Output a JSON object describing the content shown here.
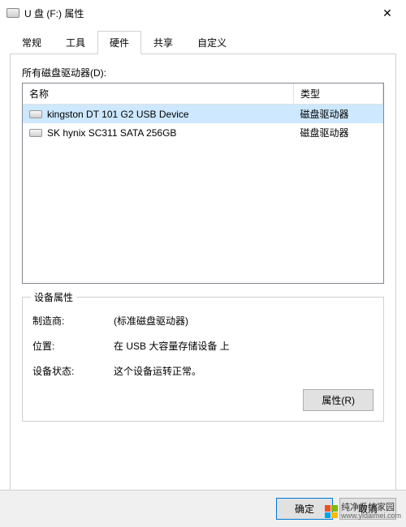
{
  "window": {
    "title": "U 盘 (F:) 属性"
  },
  "tabs": [
    {
      "label": "常规"
    },
    {
      "label": "工具"
    },
    {
      "label": "硬件"
    },
    {
      "label": "共享"
    },
    {
      "label": "自定义"
    }
  ],
  "active_tab_index": 2,
  "list_label": "所有磁盘驱动器(D):",
  "columns": {
    "name": "名称",
    "type": "类型"
  },
  "drives": [
    {
      "name": "kingston DT 101 G2 USB Device",
      "type": "磁盘驱动器",
      "selected": true
    },
    {
      "name": "SK hynix SC311 SATA 256GB",
      "type": "磁盘驱动器",
      "selected": false
    }
  ],
  "props": {
    "legend": "设备属性",
    "manufacturer_label": "制造商:",
    "manufacturer_value": "(标准磁盘驱动器)",
    "location_label": "位置:",
    "location_value": "在 USB 大容量存储设备 上",
    "status_label": "设备状态:",
    "status_value": "这个设备运转正常。",
    "properties_button": "属性(R)"
  },
  "buttons": {
    "ok": "确定",
    "cancel": "取消"
  },
  "watermark": {
    "title": "纯净系统家园",
    "sub": "www.yidaimei.com"
  }
}
